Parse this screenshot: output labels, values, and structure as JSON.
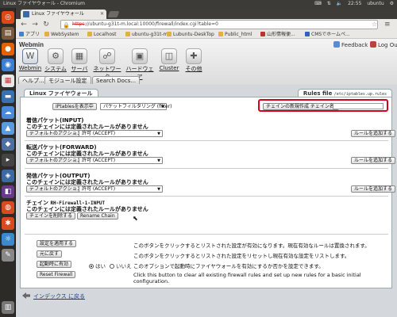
{
  "os_panel": {
    "title": "Linux ファイヤウォール - Chromium",
    "time": "22:55",
    "user": "ubuntu"
  },
  "browser": {
    "tab_title": "Linux ファイヤウォール",
    "url_prefix": "https",
    "url_rest": "://ubuntu-g31t-m.local:10000/firewall/index.cgi?table=0",
    "bookmarks": [
      "アプリ",
      "WebSystem",
      "Localhost",
      "ubuntu-g31t-m",
      "Lubuntu-DeskTop",
      "Public_html",
      "山形情報便...",
      "CMSでホームペ..."
    ]
  },
  "webmin": {
    "logo": "Webmin",
    "feedback": "Feedback",
    "logout": "Log Out",
    "categories": [
      "Webmin",
      "システム",
      "サーバ",
      "ネットワーク",
      "ハードウェア",
      "Cluster",
      "その他"
    ],
    "subtabs": [
      "ヘルプ...",
      "モジュール設定",
      "Search Docs..."
    ]
  },
  "module": {
    "title_left": "Linux ファイヤウォール",
    "title_right": "Rules file",
    "rules_path": "/etc/iptables.up.rules",
    "show_iptables_btn": "IPtablesを表示中",
    "table_select": "パケットフィルタリング (filter)",
    "create_chain_btn": "チェインの新規作成 チェイン名:",
    "chain_name_value": "",
    "no_rules": "このチェインには定義されたルールがありません",
    "default_action_btn": "デフォルトのアクション:",
    "accept_option": "許可 (ACCEPT)",
    "add_rule_btn": "ルールを追加する",
    "sections": [
      {
        "title": "着信パケット(INPUT)"
      },
      {
        "title": "転送パケット(FORWARD)"
      },
      {
        "title": "発信パケット(OUTPUT)"
      }
    ],
    "chain_label": "チェイン",
    "chain_name": "RH-Firewall-1-INPUT",
    "delete_chain_btn": "チェインを削除する",
    "rename_chain_btn": "Rename Chain",
    "apply_btn": "設定を適用する",
    "apply_desc": "このボタンをクリックするとリストされた設定が有効になります。現在有効なルールは置換されます。",
    "revert_btn": "元に戻す",
    "revert_desc": "このボタンをクリックするとリストされた設定をリセットし現在有効な設定をリストします。",
    "boot_btn": "起動時に有効",
    "boot_yes": "はい",
    "boot_no": "いいえ",
    "boot_desc": "このオプションで起動時にファイヤウォールを有効にするか否かを設定できます。",
    "reset_btn": "Reset Firewall",
    "reset_desc_1": "Click this button to clear all existing firewall rules and set up new rules for a basic initial",
    "reset_desc_2": "configuration.",
    "back_link": "インデックス に戻る"
  },
  "colors": {
    "highlight": "#d6001c",
    "link": "#1a3e8c"
  }
}
